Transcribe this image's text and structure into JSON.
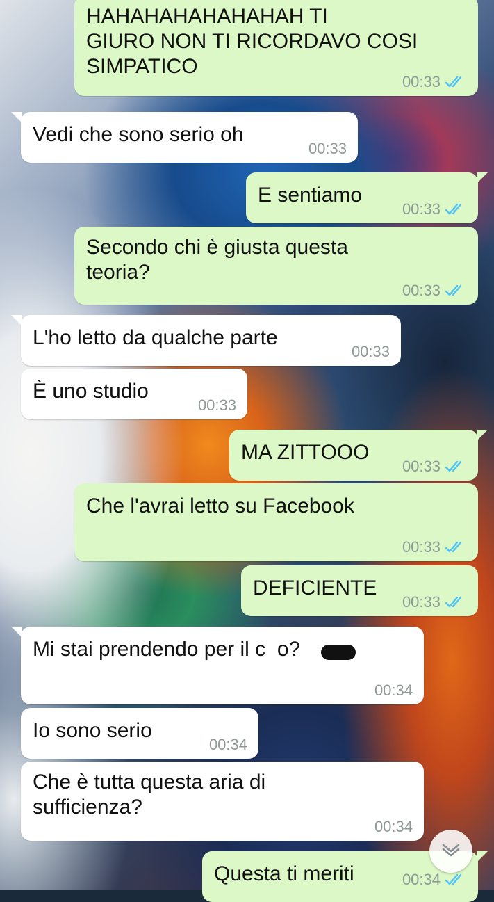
{
  "messages": [
    {
      "dir": "out",
      "text": "HAHAHAHAHAHAHAH TI\nGIURO NON TI RICORDAVO COSI\nSIMPATICO",
      "time": "00:33",
      "ticks": "read"
    },
    {
      "dir": "in",
      "text": "Vedi che sono serio oh",
      "time": "00:33"
    },
    {
      "dir": "out",
      "text": "E sentiamo",
      "time": "00:33",
      "ticks": "read"
    },
    {
      "dir": "out",
      "text": "Secondo chi è giusta questa\nteoria?",
      "time": "00:33",
      "ticks": "read"
    },
    {
      "dir": "in",
      "text": "L'ho letto da qualche parte",
      "time": "00:33"
    },
    {
      "dir": "in",
      "text": "È uno studio",
      "time": "00:33"
    },
    {
      "dir": "out",
      "text": "MA ZITTOOO",
      "time": "00:33",
      "ticks": "read"
    },
    {
      "dir": "out",
      "text": "Che l'avrai letto su Facebook",
      "time": "00:33",
      "ticks": "read"
    },
    {
      "dir": "out",
      "text": "DEFICIENTE",
      "time": "00:33",
      "ticks": "read"
    },
    {
      "dir": "in",
      "text": "Mi stai prendendo per il c  o?",
      "time": "00:34"
    },
    {
      "dir": "in",
      "text": "Io sono serio",
      "time": "00:34"
    },
    {
      "dir": "in",
      "text": "Che è tutta questa aria di\nsufficienza?",
      "time": "00:34"
    },
    {
      "dir": "out",
      "text": "Questa ti meriti",
      "time": "00:34",
      "ticks": "read"
    }
  ],
  "colors": {
    "incoming_bubble": "#ffffff",
    "outgoing_bubble": "#dcf8c6",
    "read_ticks": "#4fc3f7",
    "timestamp": "#8f9a96"
  },
  "icons": {
    "read_receipt": "double-check-icon",
    "scroll": "chevron-down-icon"
  }
}
